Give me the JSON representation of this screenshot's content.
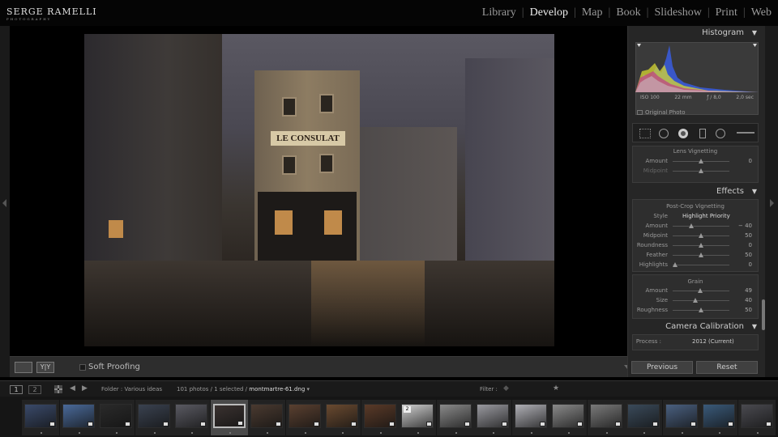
{
  "brand": {
    "name": "SERGE RAMELLI",
    "tagline": "PHOTOGRAPHY"
  },
  "modules": [
    {
      "label": "Library",
      "active": false
    },
    {
      "label": "Develop",
      "active": true
    },
    {
      "label": "Map",
      "active": false
    },
    {
      "label": "Book",
      "active": false
    },
    {
      "label": "Slideshow",
      "active": false
    },
    {
      "label": "Print",
      "active": false
    },
    {
      "label": "Web",
      "active": false
    }
  ],
  "photo": {
    "sign_text": "LE CONSULAT"
  },
  "toolbar": {
    "soft_proofing_label": "Soft Proofing",
    "compare_label": "Y|Y"
  },
  "histogram": {
    "title": "Histogram",
    "iso": "ISO 100",
    "focal": "22 mm",
    "aperture": "ƒ / 8,0",
    "shutter": "2,0 sec",
    "original_photo_label": "Original Photo"
  },
  "lens_vignetting": {
    "title": "Lens Vignetting",
    "rows": [
      {
        "label": "Amount",
        "value": "0",
        "level": 0.5
      },
      {
        "label": "Midpoint",
        "value": "",
        "level": 0.5
      }
    ]
  },
  "effects": {
    "title": "Effects",
    "post_crop_title": "Post-Crop Vignetting",
    "style_label": "Style",
    "style_value": "Highlight Priority",
    "rows": [
      {
        "label": "Amount",
        "value": "− 40",
        "level": 0.3
      },
      {
        "label": "Midpoint",
        "value": "50",
        "level": 0.5
      },
      {
        "label": "Roundness",
        "value": "0",
        "level": 0.5
      },
      {
        "label": "Feather",
        "value": "50",
        "level": 0.5
      },
      {
        "label": "Highlights",
        "value": "0",
        "level": 0.0
      }
    ],
    "grain_title": "Grain",
    "grain_rows": [
      {
        "label": "Amount",
        "value": "49",
        "level": 0.49
      },
      {
        "label": "Size",
        "value": "40",
        "level": 0.4
      },
      {
        "label": "Roughness",
        "value": "50",
        "level": 0.5
      }
    ]
  },
  "camera_calibration": {
    "title": "Camera Calibration",
    "process_label": "Process :",
    "process_value": "2012 (Current)"
  },
  "buttons": {
    "previous": "Previous",
    "reset": "Reset"
  },
  "filmstrip_bar": {
    "page1": "1",
    "page2": "2",
    "folder": "Folder : Various ideas",
    "count": "101 photos / 1 selected /",
    "filename": "montmartre-61.dng",
    "filter_label": "Filter :"
  },
  "thumbnails": [
    {
      "color": "#3a4a6a"
    },
    {
      "color": "#4a6a9a"
    },
    {
      "color": "#2a2a2a"
    },
    {
      "color": "#3a4250"
    },
    {
      "color": "#5a5a62"
    },
    {
      "color": "#3a3230",
      "selected": true
    },
    {
      "color": "#4a3a30"
    },
    {
      "color": "#5a4030"
    },
    {
      "color": "#6a4a30"
    },
    {
      "color": "#5a3a28"
    },
    {
      "color": "#cfcfcf",
      "number": "2"
    },
    {
      "color": "#8a8a8a"
    },
    {
      "color": "#9a9aa0"
    },
    {
      "color": "#b0b0b6"
    },
    {
      "color": "#8a8a8a"
    },
    {
      "color": "#7a7a7a"
    },
    {
      "color": "#3a4a5a"
    },
    {
      "color": "#4a6080"
    },
    {
      "color": "#3a5a7a"
    },
    {
      "color": "#4a4a50"
    }
  ]
}
